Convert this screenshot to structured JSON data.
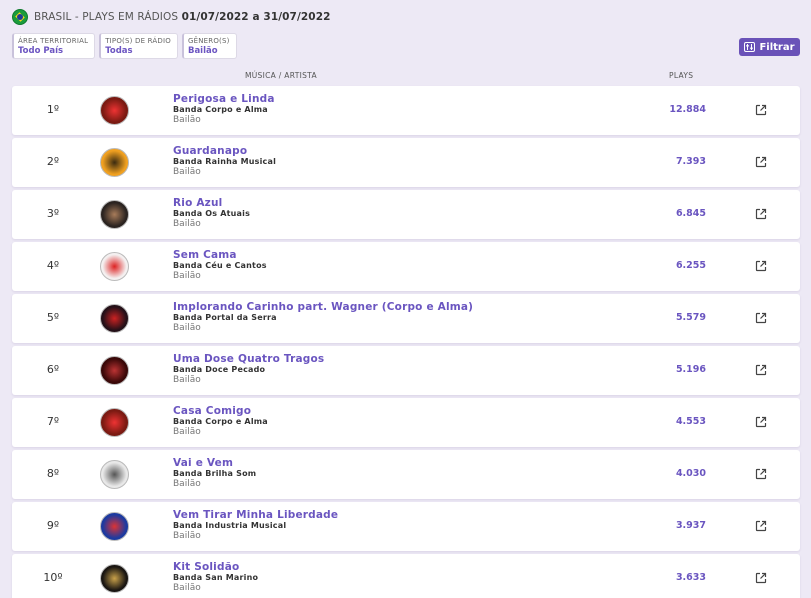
{
  "header": {
    "prefix": "BRASIL - PLAYS EM RÁDIOS",
    "dates": "01/07/2022 a 31/07/2022"
  },
  "filters": [
    {
      "label": "ÁREA TERRITORIAL",
      "value": "Todo País"
    },
    {
      "label": "TIPO(S) DE RÁDIO",
      "value": "Todas"
    },
    {
      "label": "GÊNERO(S)",
      "value": "Bailão"
    }
  ],
  "filter_button": {
    "label": "Filtrar",
    "icon": "sliders-icon"
  },
  "columns": {
    "music": "MÚSICA / ARTISTA",
    "plays": "PLAYS"
  },
  "colors": {
    "accent": "#6a55c0",
    "button": "#6a52b8",
    "background": "#ede9f5"
  },
  "rows": [
    {
      "rank": "1º",
      "title": "Perigosa e Linda",
      "artist": "Banda Corpo e Alma",
      "genre": "Bailão",
      "plays": "12.884",
      "cover_bg": "#7a1a12",
      "cover_fg": "#e33",
      "cover_text": "",
      "icon": "external-link-icon"
    },
    {
      "rank": "2º",
      "title": "Guardanapo",
      "artist": "Banda Rainha Musical",
      "genre": "Bailão",
      "plays": "7.393",
      "cover_bg": "#f0a020",
      "cover_fg": "#3a2a10",
      "cover_text": "",
      "icon": "external-link-icon"
    },
    {
      "rank": "3º",
      "title": "Rio Azul",
      "artist": "Banda Os Atuais",
      "genre": "Bailão",
      "plays": "6.845",
      "cover_bg": "#2a2320",
      "cover_fg": "#a87c5a",
      "cover_text": "",
      "icon": "external-link-icon"
    },
    {
      "rank": "4º",
      "title": "Sem Cama",
      "artist": "Banda Céu e Cantos",
      "genre": "Bailão",
      "plays": "6.255",
      "cover_bg": "#f4f0f0",
      "cover_fg": "#d22",
      "cover_text": "",
      "icon": "external-link-icon"
    },
    {
      "rank": "5º",
      "title": "Implorando Carinho part. Wagner (Corpo e Alma)",
      "artist": "Banda Portal da Serra",
      "genre": "Bailão",
      "plays": "5.579",
      "cover_bg": "#241018",
      "cover_fg": "#c22",
      "cover_text": "",
      "icon": "external-link-icon"
    },
    {
      "rank": "6º",
      "title": "Uma Dose Quatro Tragos",
      "artist": "Banda Doce Pecado",
      "genre": "Bailão",
      "plays": "5.196",
      "cover_bg": "#3a0808",
      "cover_fg": "#b33",
      "cover_text": "",
      "icon": "external-link-icon"
    },
    {
      "rank": "7º",
      "title": "Casa Comigo",
      "artist": "Banda Corpo e Alma",
      "genre": "Bailão",
      "plays": "4.553",
      "cover_bg": "#7a1a12",
      "cover_fg": "#e33",
      "cover_text": "",
      "icon": "external-link-icon"
    },
    {
      "rank": "8º",
      "title": "Vai e Vem",
      "artist": "Banda Brilha Som",
      "genre": "Bailão",
      "plays": "4.030",
      "cover_bg": "#e8e8e8",
      "cover_fg": "#555",
      "cover_text": "",
      "icon": "external-link-icon"
    },
    {
      "rank": "9º",
      "title": "Vem Tirar Minha Liberdade",
      "artist": "Banda Industria Musical",
      "genre": "Bailão",
      "plays": "3.937",
      "cover_bg": "#1c3aa0",
      "cover_fg": "#d33",
      "cover_text": "",
      "icon": "external-link-icon"
    },
    {
      "rank": "10º",
      "title": "Kit Solidão",
      "artist": "Banda San Marino",
      "genre": "Bailão",
      "plays": "3.633",
      "cover_bg": "#1a1612",
      "cover_fg": "#c9a14a",
      "cover_text": "",
      "icon": "external-link-icon"
    }
  ]
}
